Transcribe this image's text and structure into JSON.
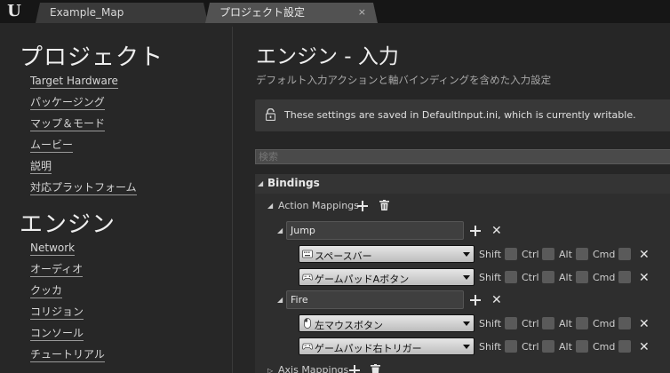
{
  "tabs": {
    "logo": "U",
    "map_tab": "Example_Map",
    "settings_tab": "プロジェクト設定",
    "close_glyph": "×"
  },
  "sidebar": {
    "project_title": "プロジェクト",
    "project_items": [
      "Target Hardware",
      "パッケージング",
      "マップ＆モード",
      "ムービー",
      "説明",
      "対応プラットフォーム"
    ],
    "engine_title": "エンジン",
    "engine_items": [
      "Network",
      "オーディオ",
      "クッカ",
      "コリジョン",
      "コンソール",
      "チュートリアル"
    ]
  },
  "main": {
    "title": "エンジン - 入力",
    "subtitle": "デフォルト入力アクションと軸バインディングを含めた入力設定",
    "notice": "These settings are saved in DefaultInput.ini, which is currently writable.",
    "search_placeholder": "検索",
    "bindings_label": "Bindings",
    "action_mappings_label": "Action Mappings",
    "axis_mappings_label": "Axis Mappings"
  },
  "modifiers": {
    "shift": "Shift",
    "ctrl": "Ctrl",
    "alt": "Alt",
    "cmd": "Cmd"
  },
  "actions": [
    {
      "name": "Jump",
      "keys": [
        {
          "label": "スペースバー",
          "icon": "keyboard-icon"
        },
        {
          "label": "ゲームパッドAボタン",
          "icon": "gamepad-icon"
        }
      ]
    },
    {
      "name": "Fire",
      "keys": [
        {
          "label": "左マウスボタン",
          "icon": "mouse-icon"
        },
        {
          "label": "ゲームパッド右トリガー",
          "icon": "gamepad-icon"
        }
      ]
    }
  ]
}
